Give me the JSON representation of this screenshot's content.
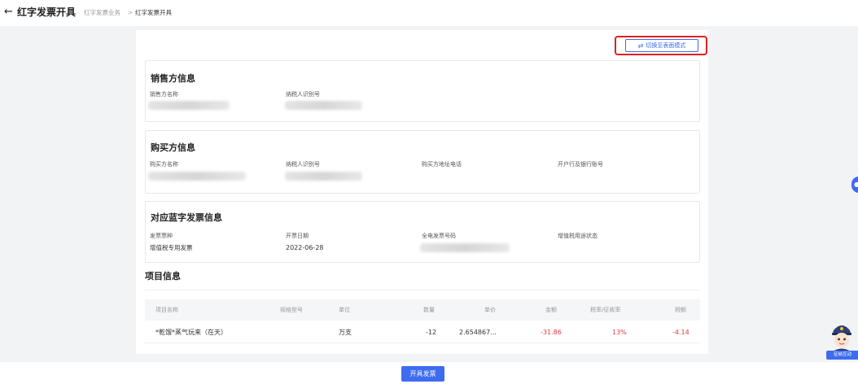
{
  "header": {
    "back_icon": "arrow-left-icon",
    "title": "红字发票开具",
    "breadcrumb": [
      "红字发票业务",
      "红字发票开具"
    ],
    "breadcrumb_separator": ">"
  },
  "switch_button": {
    "icon": "swap-arrows-icon",
    "label": "切换至表面模式",
    "highlight_color": "#e02020"
  },
  "seller": {
    "title": "销售方信息",
    "fields": [
      {
        "label": "销售方名称"
      },
      {
        "label": "纳税人识别号"
      }
    ]
  },
  "buyer": {
    "title": "购买方信息",
    "fields": [
      {
        "label": "购买方名称"
      },
      {
        "label": "纳税人识别号"
      },
      {
        "label": "购买方地址电话"
      },
      {
        "label": "开户行及银行账号"
      }
    ]
  },
  "blue_invoice": {
    "title": "对应蓝字发票信息",
    "fields": [
      {
        "label": "发票票种",
        "value": "增值税专用发票"
      },
      {
        "label": "开票日期",
        "value": "2022-06-28"
      },
      {
        "label": "全电发票号码"
      },
      {
        "label": "增值税用途状态"
      }
    ]
  },
  "items": {
    "title": "项目信息",
    "columns": [
      "项目名称",
      "规格型号",
      "单位",
      "数量",
      "单价",
      "金额",
      "税率/征收率",
      "税额"
    ],
    "rows": [
      {
        "name": "*乾馏*蒸气玩来（在天）",
        "spec": "",
        "unit": "万支",
        "quantity": "-12",
        "price": "2.654867...",
        "amount": "-31.86",
        "rate": "13%",
        "tax": "-4.14"
      }
    ]
  },
  "footer": {
    "issue_label": "开具发票"
  },
  "assistant": {
    "icon": "tax-officer-avatar-icon",
    "label": "征纳互动"
  },
  "side_tab": {
    "icon": "chat-bubble-icon"
  },
  "colors": {
    "primary": "#3d6cf0",
    "negative": "#e23b3b"
  }
}
